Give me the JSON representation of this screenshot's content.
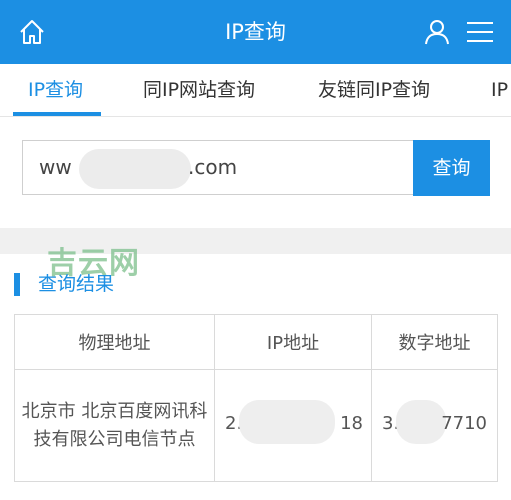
{
  "header": {
    "title": "IP查询",
    "home_icon": "home-icon",
    "user_icon": "user-icon",
    "menu_icon": "menu-icon",
    "bg_color": "#1c8fe3"
  },
  "tabs": [
    {
      "label": "IP查询",
      "active": true
    },
    {
      "label": "同IP网站查询",
      "active": false
    },
    {
      "label": "友链同IP查询",
      "active": false
    },
    {
      "label": "IP",
      "active": false
    }
  ],
  "search": {
    "input_prefix": "ww",
    "input_suffix": ".com",
    "button_label": "查询"
  },
  "watermark": "吉云网",
  "section": {
    "title": "查询结果"
  },
  "table": {
    "headers": [
      "物理地址",
      "IP地址",
      "数字地址"
    ],
    "rows": [
      {
        "location": "北京市 北京百度网讯科技有限公司电信节点",
        "ip_prefix": "2.",
        "ip_suffix": "18",
        "num_prefix": "3.",
        "num_suffix": "7710"
      }
    ]
  }
}
